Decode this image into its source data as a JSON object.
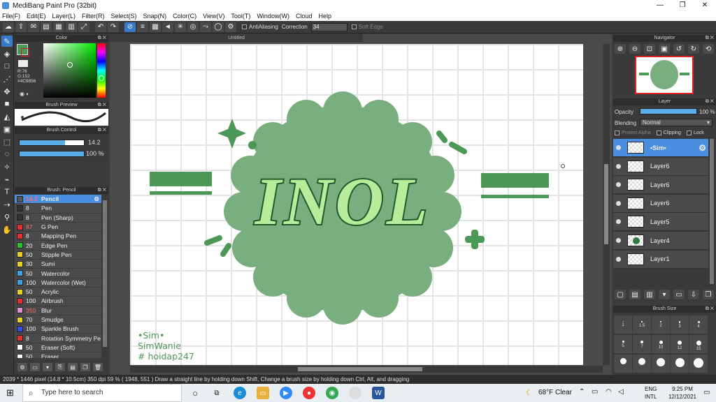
{
  "window": {
    "title": "MediBang Paint Pro (32bit)",
    "minimize": "—",
    "maximize": "❐",
    "close": "✕"
  },
  "menu": [
    "File(F)",
    "Edit(E)",
    "Layer(L)",
    "Filter(R)",
    "Select(S)",
    "Snap(N)",
    "Color(C)",
    "View(V)",
    "Tool(T)",
    "Window(W)",
    "Cloud",
    "Help"
  ],
  "toolbar": {
    "antialiasing_label": "AntiAliasing",
    "correction_label": "Correction",
    "correction_value": "34",
    "soft_edge_label": "Soft Edge"
  },
  "panels": {
    "color": "Color",
    "brush_preview": "Brush Preview",
    "brush_control": "Brush Control",
    "brush_list": "Brush: Pencil",
    "navigator": "Navigator",
    "layer": "Layer",
    "brush_size": "Brush Size"
  },
  "color": {
    "r": "R:76",
    "g": "G:152",
    "hex": "#4C9856",
    "current": "#4c9856"
  },
  "brush_control": {
    "size": "14.2",
    "opacity": "100 %",
    "size_fraction": 0.71,
    "opacity_fraction": 1.0
  },
  "brushes": [
    {
      "size": "14.2",
      "name": "Pencil",
      "color": "#555555",
      "selected": true
    },
    {
      "size": "8",
      "name": "Pen",
      "color": "#333333"
    },
    {
      "size": "8",
      "name": "Pen (Sharp)",
      "color": "#333333"
    },
    {
      "size": "87",
      "name": "G Pen",
      "color": "#e03030"
    },
    {
      "size": "8",
      "name": "Mapping Pen",
      "color": "#e03030"
    },
    {
      "size": "20",
      "name": "Edge Pen",
      "color": "#30c030"
    },
    {
      "size": "50",
      "name": "Stipple Pen",
      "color": "#e8d020"
    },
    {
      "size": "30",
      "name": "Sumi",
      "color": "#e8d020"
    },
    {
      "size": "50",
      "name": "Watercolor",
      "color": "#40a0e0"
    },
    {
      "size": "100",
      "name": "Watercolor (Wet)",
      "color": "#40a0e0"
    },
    {
      "size": "50",
      "name": "Acrylic",
      "color": "#e8d020"
    },
    {
      "size": "100",
      "name": "Airbrush",
      "color": "#e03030"
    },
    {
      "size": "350",
      "name": "Blur",
      "color": "#e090d0"
    },
    {
      "size": "70",
      "name": "Smudge",
      "color": "#e8d020"
    },
    {
      "size": "100",
      "name": "Sparkle Brush",
      "color": "#3050e0"
    },
    {
      "size": "8",
      "name": "Rotation Symmetry Pe",
      "color": "#e03030"
    },
    {
      "size": "50",
      "name": "Eraser (Soft)",
      "color": "#ffffff"
    },
    {
      "size": "50",
      "name": "Eraser",
      "color": "#ffffff"
    }
  ],
  "document": {
    "tab": "Untitled"
  },
  "artwork": {
    "title_text": "INOL",
    "credit_lines": [
      "•Sim•",
      "SimWanie",
      "# hoidap247"
    ]
  },
  "layer": {
    "opacity_label": "Opacity",
    "opacity_value": "100 %",
    "blending_label": "Blending",
    "blending_value": "Normal",
    "protect_alpha": "Protect Alpha",
    "clipping": "Clipping",
    "lock": "Lock"
  },
  "layers": [
    {
      "name": "•Sim•",
      "selected": true
    },
    {
      "name": "Layer6"
    },
    {
      "name": "Layer6"
    },
    {
      "name": "Layer6"
    },
    {
      "name": "Layer5"
    },
    {
      "name": "Layer4"
    },
    {
      "name": "Layer1"
    }
  ],
  "brush_sizes": [
    "1",
    "1.5",
    "2",
    "3",
    "4",
    "5",
    "7",
    "10",
    "12",
    "15",
    "5",
    "7",
    "10",
    "12",
    "15"
  ],
  "status": "2039 * 1446 pixel   (14.8 * 10.5cm)   350 dpi   59 %   ( 1948, 551 )   Draw a straight line by holding down Shift, Change a brush size by holding down Ctrl, Alt, and dragging",
  "taskbar": {
    "search_placeholder": "Type here to search",
    "weather": "68°F  Clear",
    "lang1": "ENG",
    "lang2": "INTL",
    "time": "9:25 PM",
    "date": "12/12/2021"
  }
}
